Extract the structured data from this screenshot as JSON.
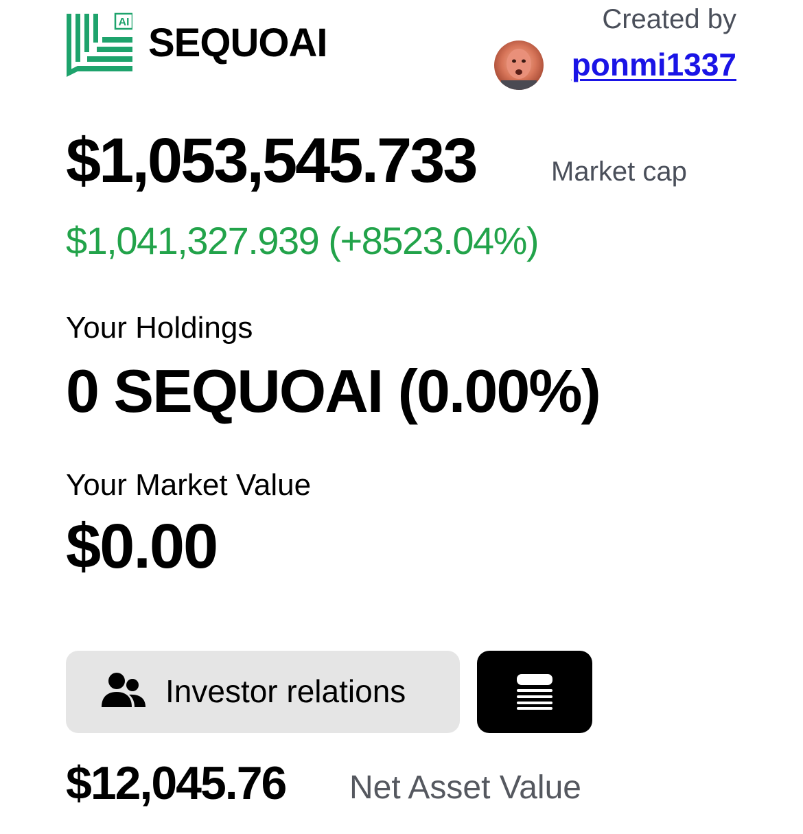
{
  "header": {
    "logo_badge": "AI",
    "brand_name": "SEQUOAI",
    "created_by_label": "Created by",
    "creator_username": "ponmi1337",
    "logo_icon": "sequoai-logo-icon",
    "avatar_icon": "creator-avatar",
    "brand_color": "#1ea36c"
  },
  "market": {
    "market_cap_value": "$1,053,545.733",
    "market_cap_label": "Market cap",
    "change_value": "$1,041,327.939 (+8523.04%)",
    "change_color": "#22a34a"
  },
  "holdings": {
    "label": "Your Holdings",
    "value": "0 SEQUOAI (0.00%)"
  },
  "market_value": {
    "label": "Your Market Value",
    "value": "$0.00"
  },
  "actions": {
    "investor_relations_label": "Investor relations",
    "investor_icon": "users-icon",
    "menu_icon": "stack-menu-icon"
  },
  "nav": {
    "value": "$12,045.76",
    "label": "Net Asset Value"
  }
}
